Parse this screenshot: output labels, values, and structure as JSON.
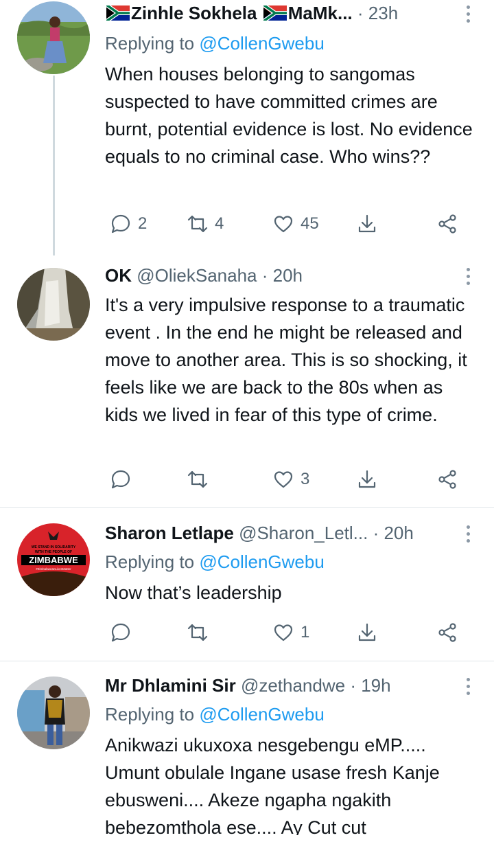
{
  "tweets": [
    {
      "name_prefix_flag": "za-flag",
      "name": "Zinhle Sokhela",
      "name_suffix_flag": "za-flag",
      "name_tail": "MaMk...",
      "handle": "",
      "time": "· 23h",
      "replying_label": "Replying to",
      "replying_to": "@CollenGwebu",
      "text": "When houses belonging to sangomas suspected to have committed crimes are burnt, potential evidence is lost. No evidence equals to no criminal case. Who wins??",
      "replies": "2",
      "retweets": "4",
      "likes": "45"
    },
    {
      "name": "OK",
      "handle": "@OliekSanaha",
      "time": "· 20h",
      "text": "It's a very impulsive response  to a traumatic event . In the end he might be released and move to another area. This is so shocking, it feels like we are back to the 80s when as kids we lived in fear of this type of crime.",
      "replies": "",
      "retweets": "",
      "likes": "3"
    },
    {
      "name": "Sharon Letlape",
      "handle": "@Sharon_Letl...",
      "time": "· 20h",
      "replying_label": "Replying to",
      "replying_to": "@CollenGwebu",
      "text": "Now that’s leadership",
      "replies": "",
      "retweets": "",
      "likes": "1",
      "avatar_text": {
        "line1": "WE STAND IN SOLIDARITY",
        "line2": "WITH THE PEOPLE OF",
        "line3": "ZIMBABWE",
        "line4": "#ZimbabweanLivesMatter"
      }
    },
    {
      "name": "Mr Dhlamini Sir",
      "handle": "@zethandwe",
      "time": "· 19h",
      "replying_label": "Replying to",
      "replying_to": "@CollenGwebu",
      "text": "Anikwazi ukuxoxa nesgebengu eMP..... Umunt obulale Ingane usase fresh Kanje ebusweni.... Akeze ngapha ngakith bebezomthola ese.... Ay Cut cut"
    }
  ],
  "icons": {
    "reply": "reply-icon",
    "retweet": "retweet-icon",
    "like": "heart-icon",
    "share": "share-icon",
    "more": "more-vertical-icon"
  },
  "colors": {
    "text": "#0f1419",
    "secondary": "#536471",
    "link": "#1d9bf0",
    "divider": "#e1e6ea"
  }
}
